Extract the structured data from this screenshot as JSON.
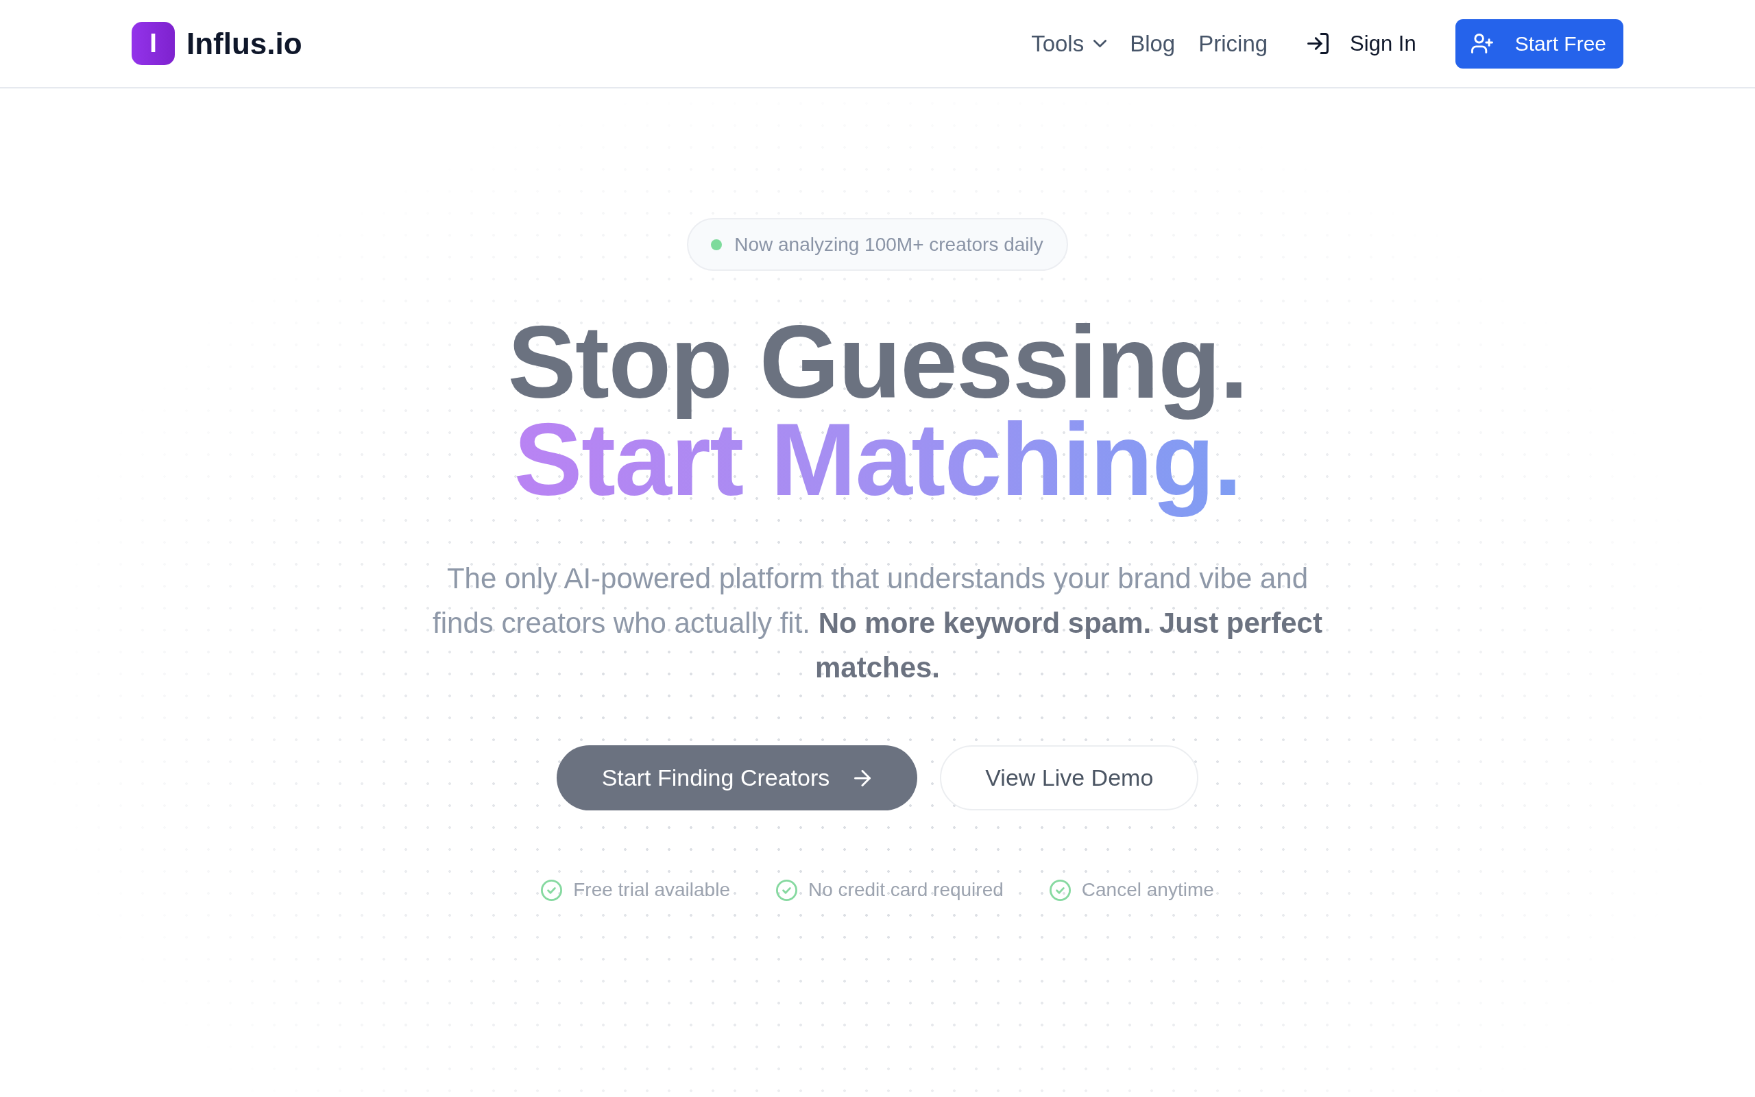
{
  "header": {
    "logo": {
      "mark": "I",
      "text": "Influs.io"
    },
    "nav": [
      {
        "label": "Tools",
        "kind": "dropdown"
      },
      {
        "label": "Blog",
        "kind": "link"
      },
      {
        "label": "Pricing",
        "kind": "link"
      }
    ],
    "sign_in": "Sign In",
    "start_free": "Start Free"
  },
  "hero": {
    "badge": "Now analyzing 100M+ creators daily",
    "headline": [
      {
        "text": "Stop Guessing.",
        "kind": "plain"
      },
      {
        "text": "Start Matching.",
        "kind": "gradient"
      }
    ],
    "subtitle": "The only AI-powered platform that understands your brand vibe and finds creators who actually fit. **No more keyword spam. Just perfect matches.**",
    "actions": [
      {
        "label": "Start Finding Creators",
        "kind": "primary"
      },
      {
        "label": "View Live Demo",
        "kind": "secondary"
      }
    ],
    "features": [
      "Free trial available",
      "No credit card required",
      "Cancel anytime"
    ]
  }
}
